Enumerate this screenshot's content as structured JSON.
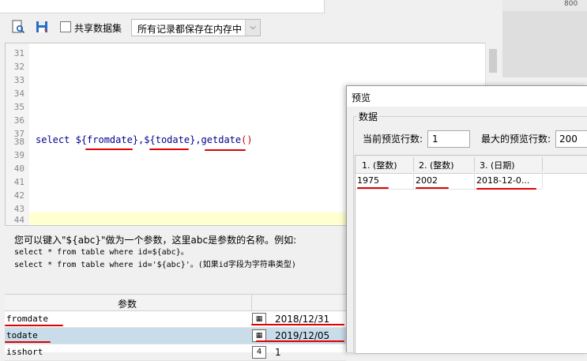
{
  "toolbar": {
    "share_label": "共享数据集",
    "memory_select": "所有记录都保存在内存中",
    "icons": [
      "query-icon",
      "save-icon",
      "chevron-down-icon"
    ]
  },
  "editor": {
    "line_numbers": [
      "31",
      "32",
      "33",
      "34",
      "35",
      "36",
      "37",
      "38",
      "39",
      "40",
      "41",
      "42",
      "43",
      "44"
    ],
    "code": {
      "prefix": "select ${",
      "param1": "fromdate",
      "mid1": "},${",
      "param2": "todate",
      "mid2": "},",
      "func": "getdate",
      "parens": "()"
    }
  },
  "help": {
    "line1": "您可以键入\"${abc}\"做为一个参数，这里abc是参数的名称。例如:",
    "line2": "select * from table where id=${abc}。",
    "line3": "select * from table where id='${abc}'。(如果id字段为字符串类型)"
  },
  "params": {
    "header": "参数",
    "rows": [
      {
        "name": "fromdate",
        "type_icon": "calendar-icon",
        "value": "2018/12/31"
      },
      {
        "name": "todate",
        "type_icon": "calendar-icon",
        "value": "2019/12/05"
      },
      {
        "name": "isshort",
        "type_glyph": "4",
        "value": "1"
      }
    ]
  },
  "ruler": {
    "label": "800"
  },
  "preview": {
    "title": "预览",
    "group_label": "数据",
    "current_rows_label": "当前预览行数:",
    "current_rows_value": "1",
    "max_rows_label": "最大的预览行数:",
    "max_rows_value": "200",
    "columns": [
      "1. (整数)",
      "2. (整数)",
      "3. (日期)"
    ],
    "rows": [
      [
        "1975",
        "2002",
        "2018-12-0..."
      ]
    ]
  },
  "colors": {
    "annotation_red": "#e00000",
    "code_blue": "#00008b",
    "highlight_row": "#c8dcea"
  }
}
